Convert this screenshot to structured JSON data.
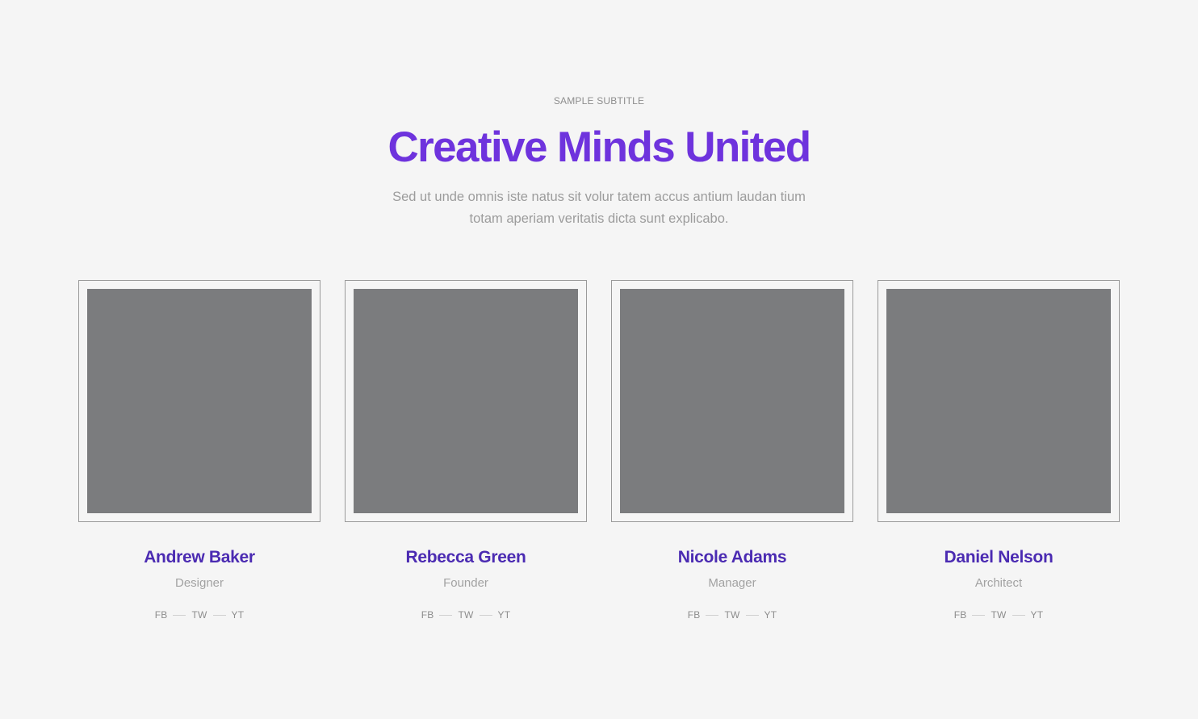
{
  "header": {
    "subtitle": "SAMPLE SUBTITLE",
    "title": "Creative Minds United",
    "description_line1": "Sed ut unde omnis iste natus sit volur tatem accus antium laudan tium",
    "description_line2": "totam aperiam veritatis dicta sunt explicabo."
  },
  "team": [
    {
      "name": "Andrew Baker",
      "role": "Designer",
      "social": [
        "FB",
        "TW",
        "YT"
      ]
    },
    {
      "name": "Rebecca Green",
      "role": "Founder",
      "social": [
        "FB",
        "TW",
        "YT"
      ]
    },
    {
      "name": "Nicole Adams",
      "role": "Manager",
      "social": [
        "FB",
        "TW",
        "YT"
      ]
    },
    {
      "name": "Daniel Nelson",
      "role": "Architect",
      "social": [
        "FB",
        "TW",
        "YT"
      ]
    }
  ],
  "colors": {
    "background": "#f5f5f5",
    "title": "#6e33dd",
    "name": "#4b2bb2",
    "photo_placeholder": "#7b7c7e",
    "muted_text": "#9c9c9c"
  }
}
